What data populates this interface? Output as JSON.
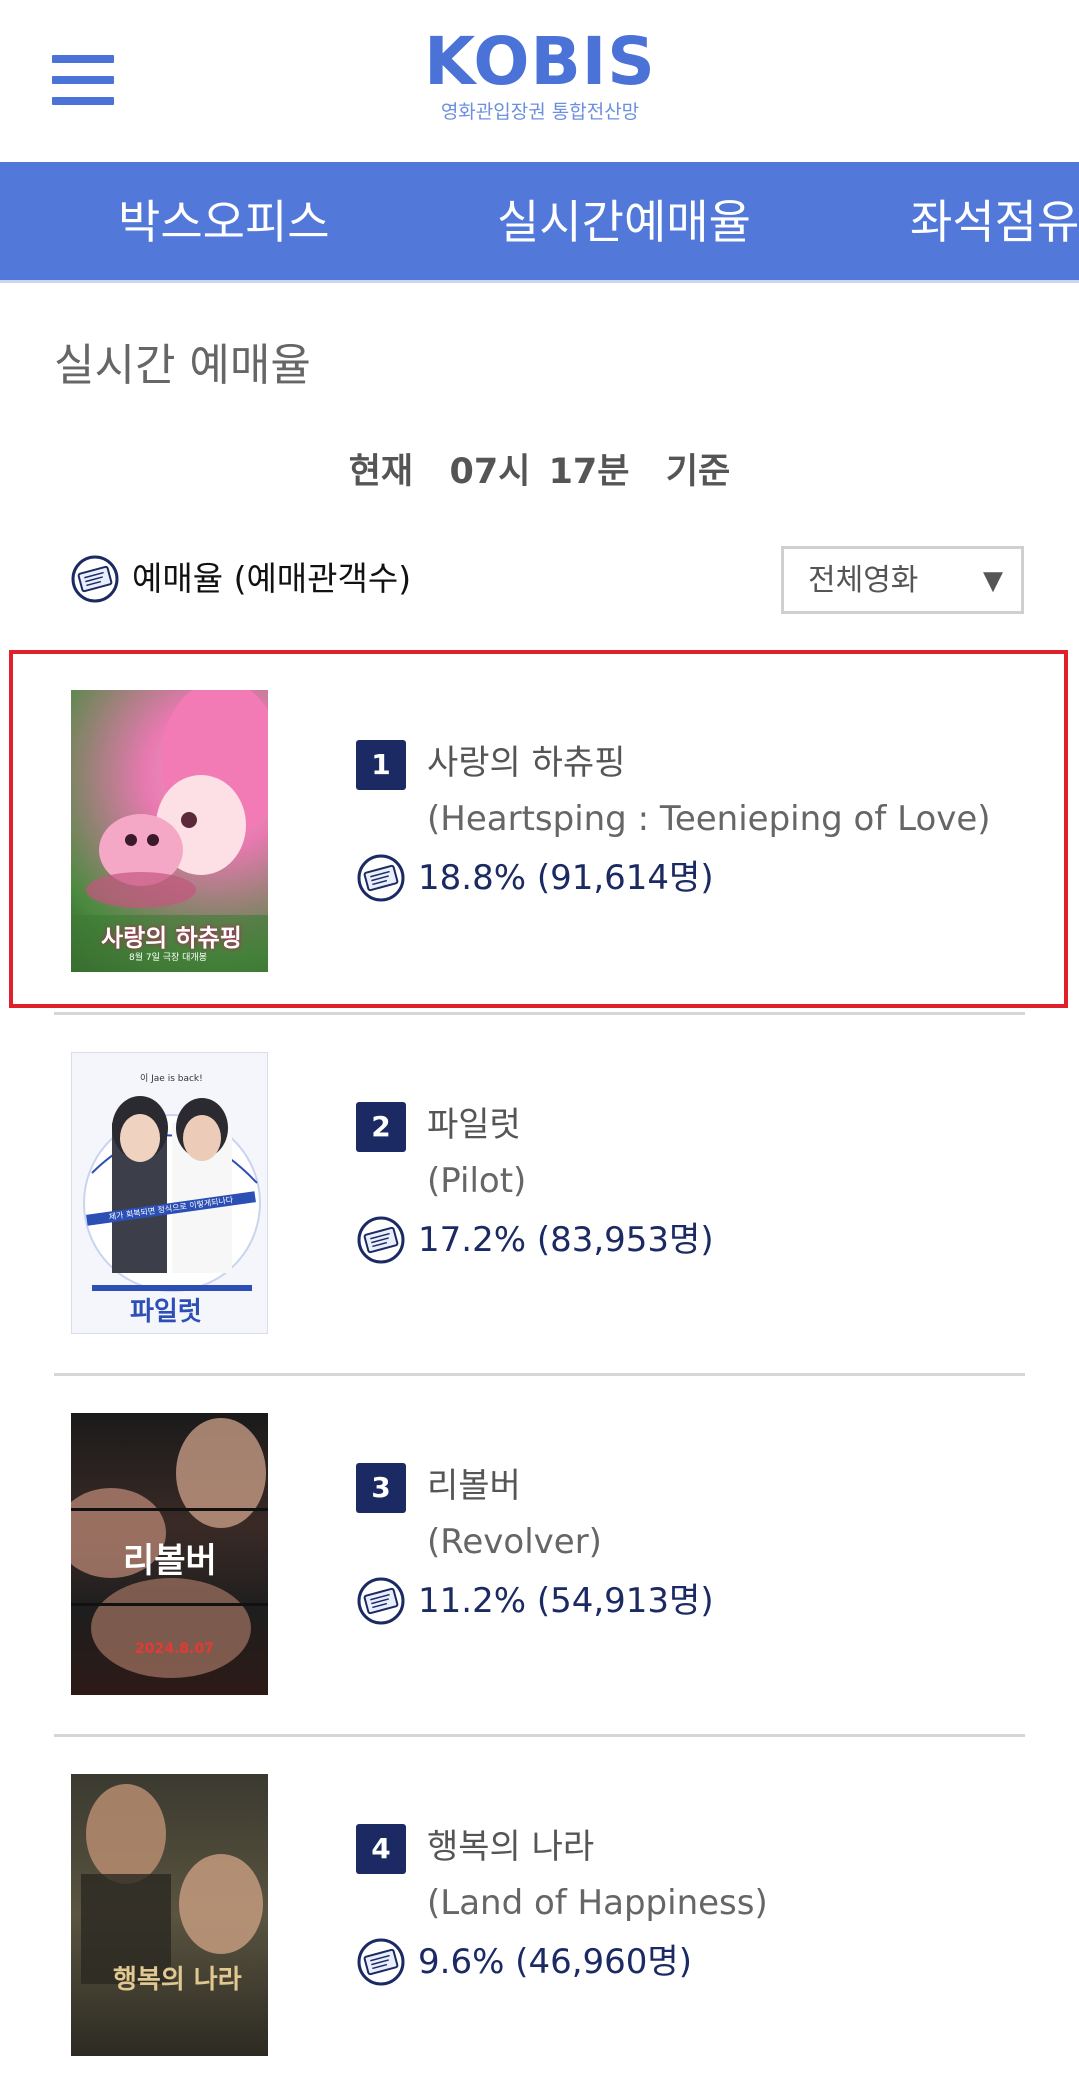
{
  "header": {
    "logo_text": "KOBIS",
    "logo_subtitle": "영화관입장권 통합전산망",
    "menu_icon": "hamburger-menu-icon",
    "accent_color": "#4b73d7"
  },
  "nav": {
    "tabs": [
      {
        "label": "박스오피스"
      },
      {
        "label": "실시간예매율"
      },
      {
        "label": "좌석점유"
      }
    ],
    "background_color": "#5279da"
  },
  "page": {
    "section_title": "실시간 예매율",
    "time_basis": "현재  07시 17분  기준",
    "legend_icon": "ticket-icon",
    "legend_label": "예매율 (예매관객수)",
    "filter": {
      "selected": "전체영화",
      "arrow_icon": "dropdown-triangle-icon"
    }
  },
  "movies": [
    {
      "rank": "1",
      "title_ko": "사랑의 하츄핑",
      "title_en": "(Heartsping : Teenieping of Love)",
      "rate": "18.8% (91,614명)",
      "poster_text": "사랑의 하츄핑",
      "poster_caption": "8월 7일 극장 대개봉",
      "highlighted": true
    },
    {
      "rank": "2",
      "title_ko": "파일럿",
      "title_en": "(Pilot)",
      "rate": "17.2% (83,953명)",
      "poster_text": "파일럿",
      "poster_tagline": "이 Jae is back!",
      "poster_subtitle": "제가 회복되면 정식으로 이렇게되나다",
      "highlighted": false
    },
    {
      "rank": "3",
      "title_ko": "리볼버",
      "title_en": "(Revolver)",
      "rate": "11.2% (54,913명)",
      "poster_text": "리볼버",
      "poster_caption": "2024.8.07",
      "highlighted": false
    },
    {
      "rank": "4",
      "title_ko": "행복의 나라",
      "title_en": "(Land of Happiness)",
      "rate": "9.6% (46,960명)",
      "poster_text": "행복의 나라",
      "highlighted": false
    }
  ]
}
